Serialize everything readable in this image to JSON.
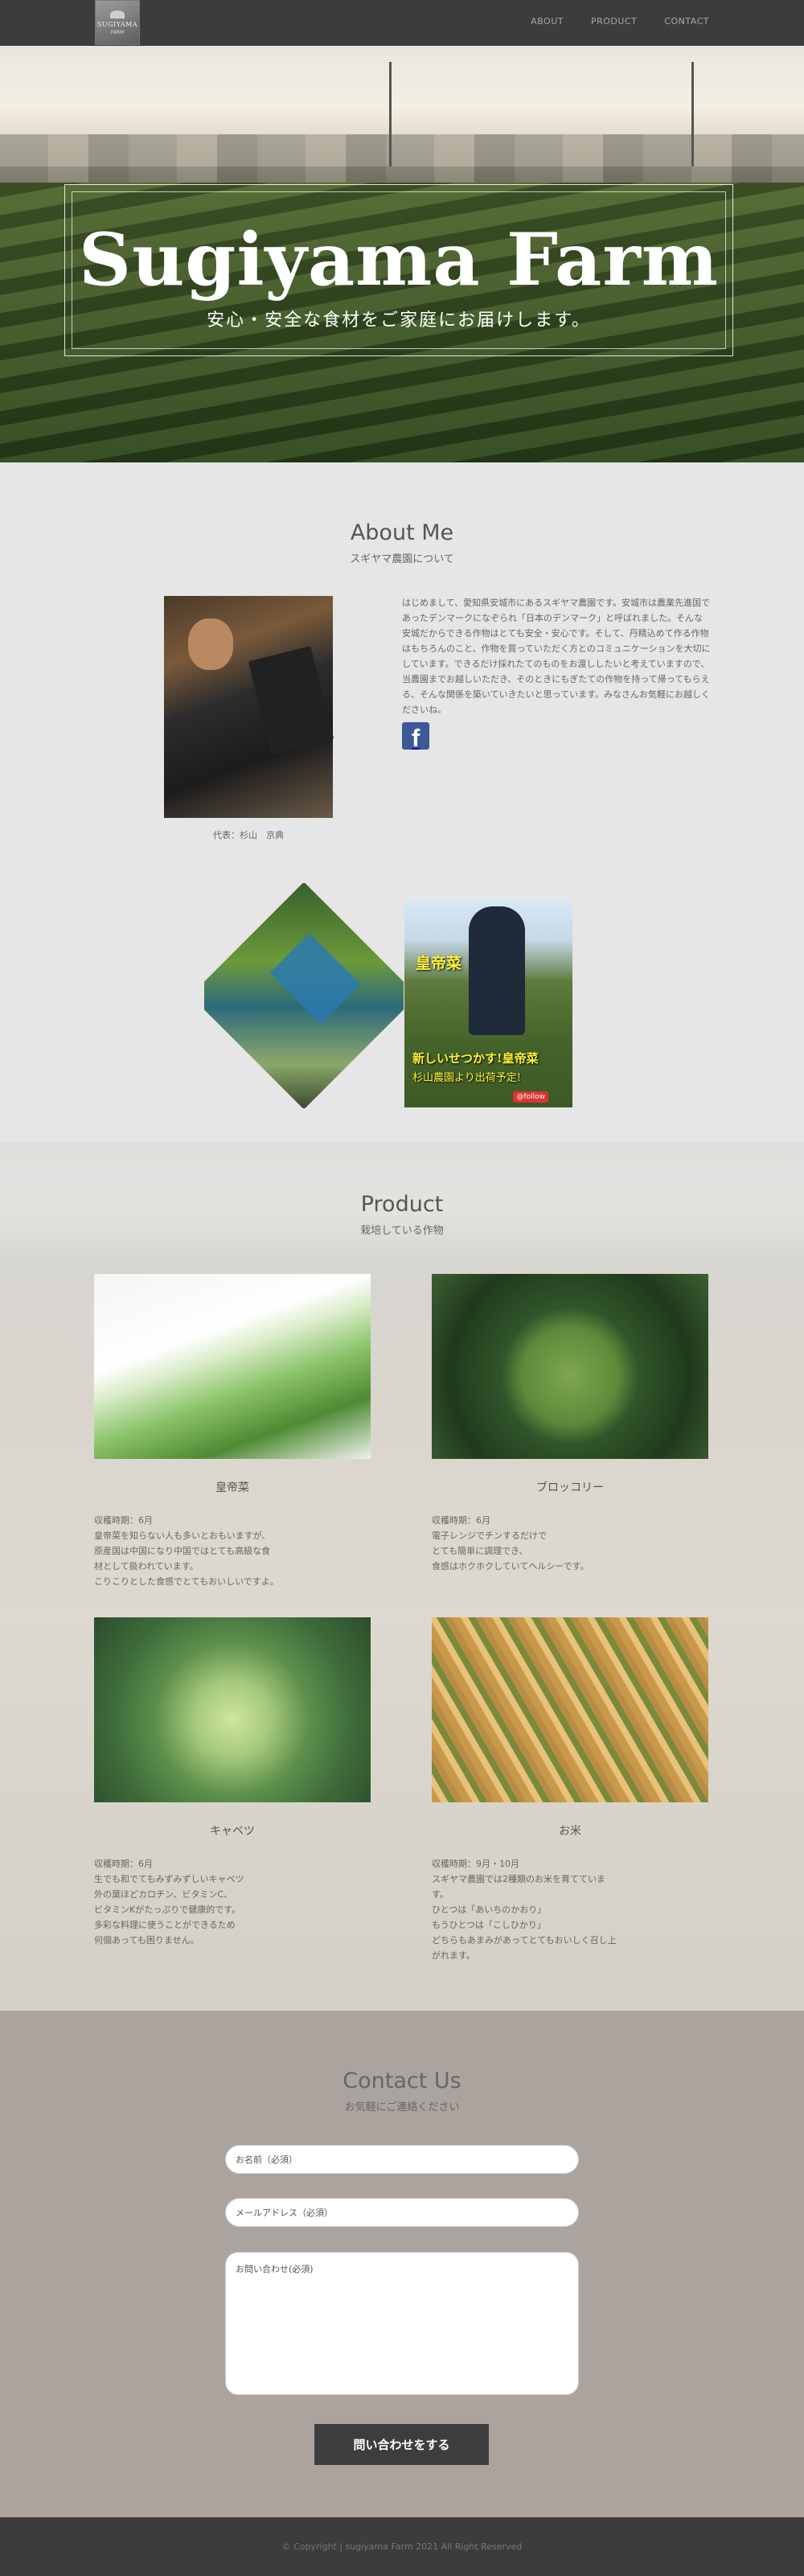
{
  "header": {
    "logo_top": "SUGIYAMA",
    "logo_bottom": "FARM",
    "nav": [
      "ABOUT",
      "PRODUCT",
      "CONTACT"
    ]
  },
  "hero": {
    "title": "Sugiyama Farm",
    "subtitle": "安心・安全な食材をご家庭にお届けします。"
  },
  "about": {
    "title": "About Me",
    "subtitle": "スギヤマ農園について",
    "caption": "代表：杉山　京典",
    "text": "はじめまして、愛知県安城市にあるスギヤマ農園です。安城市は農業先進国であったデンマークになぞられ「日本のデンマーク」と呼ばれました。そんな安城だからできる作物はとても安全・安心です。そして、丹精込めて作る作物はもちろんのこと、作物を買っていただく方とのコミュニケーションを大切にしています。できるだけ採れたてのものをお渡ししたいと考えていますので、当農園までお越しいただき、そのときにもぎたての作物を持って帰ってもらえる、そんな関係を築いていきたいと思っています。みなさんお気軽にお越しくださいね。",
    "facebook_icon": "facebook-icon",
    "post_text_1": "皇帝菜",
    "post_text_2": "新しいせつかす!皇帝菜",
    "post_text_3": "杉山農園より出荷予定!",
    "post_badge": "@follow"
  },
  "product": {
    "title": "Product",
    "subtitle": "栽培している作物",
    "items": [
      {
        "name": "皇帝菜",
        "desc": "収穫時期：6月\n皇帝菜を知らない人も多いとおもいますが、原産国は中国になり中国ではとても高級な食材として扱われています。\nこりこりとした食感でとてもおいしいですよ。"
      },
      {
        "name": "ブロッコリー",
        "desc": "収穫時期：6月\n電子レンジでチンするだけで\nとても簡単に調理でき、\n食感はホクホクしていてヘルシーです。"
      },
      {
        "name": "キャベツ",
        "desc": "収穫時期：6月\n生でも和でてもみずみずしいキャベツ\n外の葉ほどカロチン、ビタミンC、\nビタミンKがたっぷりで健康的です。\n多彩な料理に使うことができるため\n何個あっても困りません。"
      },
      {
        "name": "お米",
        "desc": "収穫時期：9月・10月\nスギヤマ農園では2種類のお米を育てています。\nひとつは「あいちのかおり」\nもうひとつは「こしひかり」\nどちらもあまみがあってとてもおいしく召し上がれます。"
      }
    ]
  },
  "contact": {
    "title": "Contact Us",
    "subtitle": "お気軽にご連絡ください",
    "name_placeholder": "お名前（必須）",
    "email_placeholder": "メールアドレス（必須）",
    "message_placeholder": "お問い合わせ(必須)",
    "submit": "問い合わせをする"
  },
  "footer": {
    "copyright": "© Copyright | sugiyama Farm 2021 All Right Reserved"
  }
}
